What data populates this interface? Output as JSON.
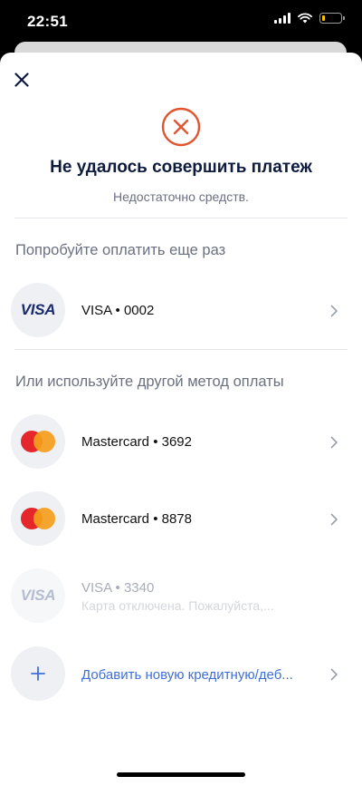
{
  "status_bar": {
    "time": "22:51"
  },
  "header": {
    "title": "Не удалось совершить платеж",
    "subtitle": "Недостаточно средств."
  },
  "retry_section": {
    "header": "Попробуйте оплатить еще раз",
    "card": {
      "brand": "VISA",
      "label": "VISA • 0002"
    }
  },
  "other_section": {
    "header": "Или используйте другой метод оплаты",
    "cards": [
      {
        "brand": "mastercard",
        "label": "Mastercard • 3692"
      },
      {
        "brand": "mastercard",
        "label": "Mastercard • 8878"
      },
      {
        "brand": "VISA",
        "label": "VISA • 3340",
        "note": "Карта отключена. Пожалуйста,..."
      }
    ],
    "add_card_label": "Добавить новую кредитную/деб..."
  },
  "colors": {
    "error_accent": "#e2552f",
    "title_text": "#0e1b3d",
    "link": "#3e6fd8",
    "mastercard_red": "#e5262b",
    "mastercard_orange": "#f59e1b",
    "visa_blue": "#1a2a6b"
  },
  "icons": {
    "close": "close-icon",
    "error": "error-x-circle-icon",
    "chevron": "chevron-right-icon",
    "add": "plus-icon"
  }
}
